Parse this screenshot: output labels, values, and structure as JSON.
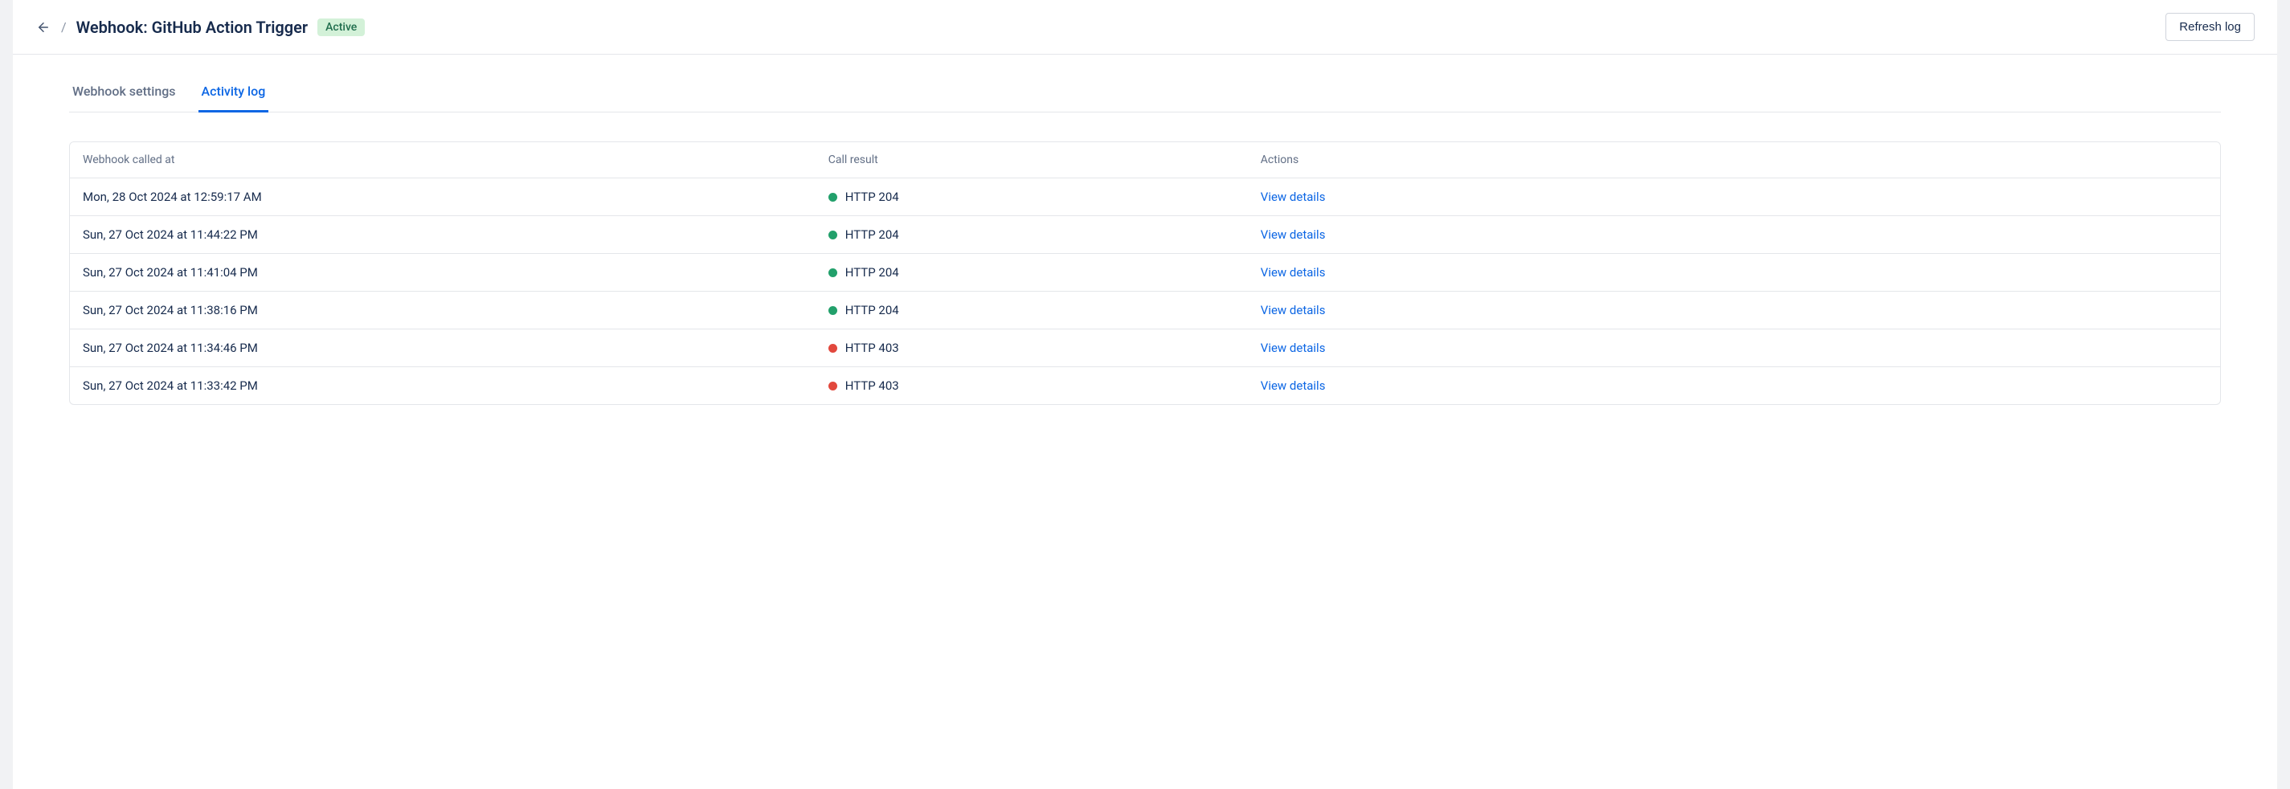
{
  "header": {
    "title": "Webhook: GitHub Action Trigger",
    "badge": "Active",
    "refresh_label": "Refresh log"
  },
  "tabs": [
    {
      "label": "Webhook settings",
      "active": false
    },
    {
      "label": "Activity log",
      "active": true
    }
  ],
  "table": {
    "columns": {
      "timestamp": "Webhook called at",
      "result": "Call result",
      "actions": "Actions"
    },
    "view_details_label": "View details",
    "rows": [
      {
        "timestamp": "Mon, 28 Oct 2024 at 12:59:17 AM",
        "result": "HTTP 204",
        "status": "success"
      },
      {
        "timestamp": "Sun, 27 Oct 2024 at 11:44:22 PM",
        "result": "HTTP 204",
        "status": "success"
      },
      {
        "timestamp": "Sun, 27 Oct 2024 at 11:41:04 PM",
        "result": "HTTP 204",
        "status": "success"
      },
      {
        "timestamp": "Sun, 27 Oct 2024 at 11:38:16 PM",
        "result": "HTTP 204",
        "status": "success"
      },
      {
        "timestamp": "Sun, 27 Oct 2024 at 11:34:46 PM",
        "result": "HTTP 403",
        "status": "error"
      },
      {
        "timestamp": "Sun, 27 Oct 2024 at 11:33:42 PM",
        "result": "HTTP 403",
        "status": "error"
      }
    ]
  }
}
